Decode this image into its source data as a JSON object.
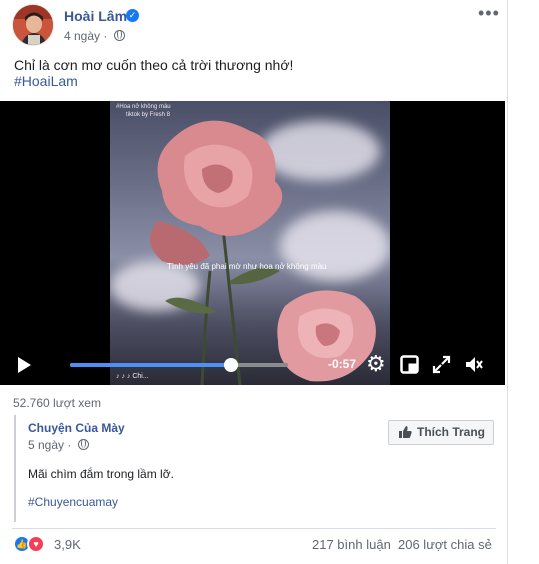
{
  "post": {
    "author": "Hoài Lâm",
    "time": "4 ngày",
    "more_label": "•••",
    "caption": "Chỉ là cơn mơ cuốn theo cả trời thương nhớ!",
    "hashtag": "#HoaiLam"
  },
  "video": {
    "overlay_title": "#Hoa nở không màu",
    "overlay_credit": "tiktok by Fresh 8",
    "subtitle": "Tình yêu đã phai mờ như hoa nở không màu",
    "watermark": "♪ ♪ ♪ Chi...",
    "time_remaining": "-0:57",
    "progress_fraction": 0.74
  },
  "views": "52.760 lượt xem",
  "shared": {
    "page_name": "Chuyện Của Mày",
    "time": "5 ngày",
    "like_page_label": "Thích Trang",
    "text": "Mãi chìm đắm trong lầm lỡ.",
    "hashtag": "#Chuyencuamay"
  },
  "footer": {
    "reaction_count": "3,9K",
    "comments": "217 bình luận",
    "shares": "206 lượt chia sẻ"
  },
  "colors": {
    "link": "#385898",
    "accent": "#4d8ef7",
    "like": "#1877f2",
    "love": "#f33e58"
  }
}
